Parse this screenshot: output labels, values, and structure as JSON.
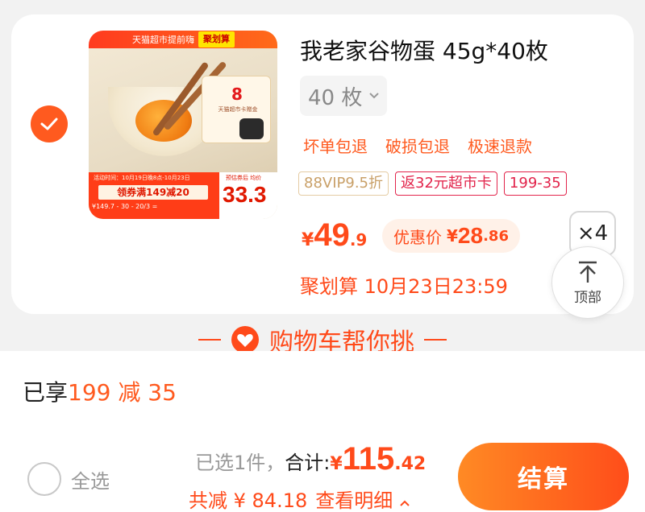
{
  "product": {
    "title": "我老家谷物蛋 45g*40枚",
    "variant": "40 枚",
    "services": [
      "坏单包退",
      "破损包退",
      "极速退款"
    ],
    "tags": [
      "88VIP9.5折",
      "返32元超市卡",
      "199-35"
    ],
    "price": {
      "currency": "¥",
      "integer": "49",
      "decimal": ".9"
    },
    "discount": {
      "label": "优惠价",
      "currency": "¥",
      "integer": "28",
      "decimal": ".86"
    },
    "quantity": "×4",
    "juhuasuan": "聚划算 10月23日23:59",
    "image": {
      "top_banner_left": "天猫超市提前嗨",
      "top_banner_right": "聚划算",
      "coupon_value": "8",
      "coupon_text": "天猫超市卡赠金",
      "promo_line1": "活动时间：10月19日晚8点-10月23日",
      "promo_main": "领券满149减20",
      "promo_line3": "¥149.7 - 30 - 20/3 =",
      "price_label": "预估券后 均价",
      "price_value": "33.3"
    }
  },
  "to_top": {
    "label": "顶部"
  },
  "helper_banner": {
    "text": "购物车帮你挑"
  },
  "bottom_bar": {
    "enjoyed_prefix": "已享",
    "enjoyed_value": "199 减 35",
    "select_all": "全选",
    "selected_count": "已选1件，",
    "total_label": "合计:",
    "total_currency": "¥",
    "total_integer": "115",
    "total_decimal": ".42",
    "saved": "共减 ¥ 84.18",
    "saved_detail": "查看明细",
    "checkout": "结算"
  },
  "colors": {
    "accent": "#ff4a1a",
    "checkout_gradient_start": "#ff8a24",
    "checkout_gradient_end": "#ff4d1a"
  },
  "icons": {
    "check": "checkmark-icon",
    "variant_arrow": "chevron-down-icon",
    "to_top": "arrow-up-icon",
    "heart": "heart-icon",
    "detail_arrow": "chevron-up-icon"
  }
}
